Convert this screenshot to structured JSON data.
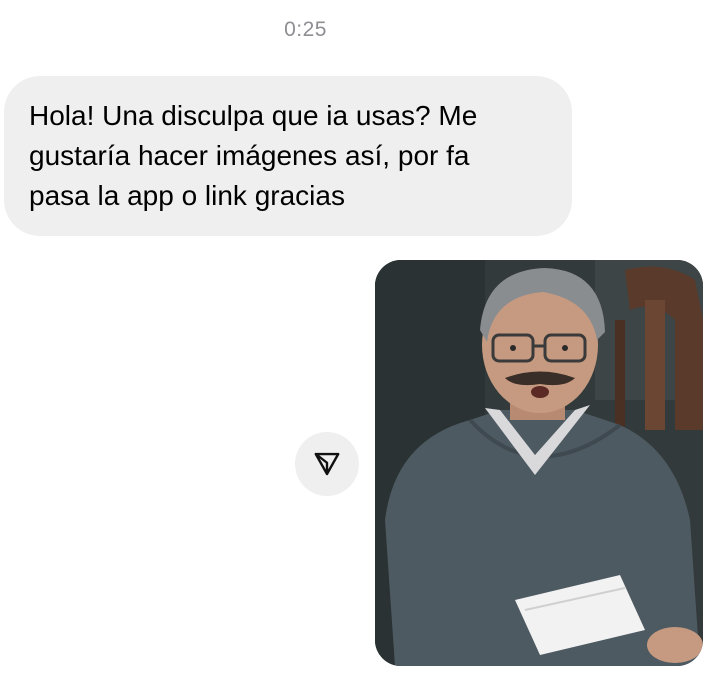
{
  "conversation": {
    "timestamp": "0:25",
    "incoming_message": {
      "lines": [
        "Hola! Una disculpa que ia usas? Me",
        "gustaría hacer imágenes así, por fa",
        "pasa la app o link gracias"
      ]
    },
    "outgoing_image": {
      "share_icon": "paper-plane-icon"
    }
  },
  "colors": {
    "incoming_bubble": "#efefef",
    "timestamp_text": "#8e8e93",
    "message_text": "#000000"
  }
}
